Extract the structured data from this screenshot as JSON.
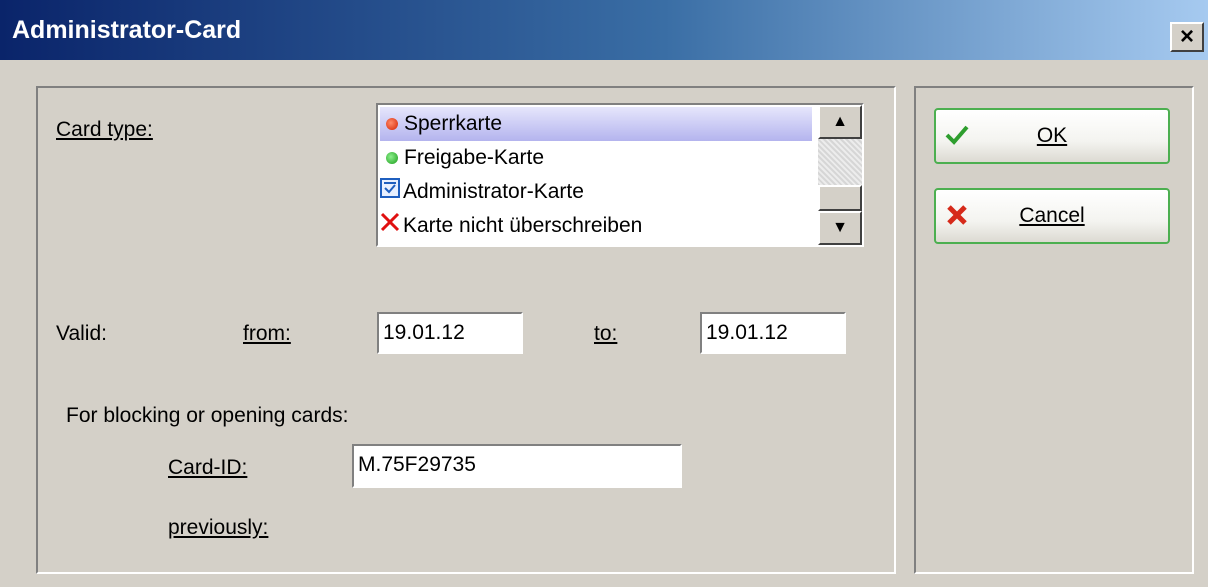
{
  "window": {
    "title": "Administrator-Card",
    "close_label": "×"
  },
  "card_type": {
    "label": "Card type:",
    "options": [
      {
        "label": "Sperrkarte",
        "icon": "red-dot-icon",
        "selected": true
      },
      {
        "label": "Freigabe-Karte",
        "icon": "green-dot-icon",
        "selected": false
      },
      {
        "label": "Administrator-Karte",
        "icon": "checkbox-icon",
        "selected": false
      },
      {
        "label": "Karte nicht überschreiben",
        "icon": "red-x-icon",
        "selected": false
      }
    ]
  },
  "validity": {
    "label": "Valid:",
    "from_label": "from:",
    "from_value": "19.01.12",
    "to_label": "to:",
    "to_value": "19.01.12"
  },
  "blocking": {
    "heading": "For blocking or opening cards:",
    "card_id_label": "Card-ID:",
    "card_id_value": "M.75F29735",
    "previously_label": "previously:"
  },
  "buttons": {
    "ok_label": "OK",
    "cancel_label": "Cancel"
  },
  "colors": {
    "titlebar_start": "#0a246a",
    "titlebar_end": "#a6caf0",
    "dialog_bg": "#d4d0c8",
    "button_border": "#4caf50"
  }
}
